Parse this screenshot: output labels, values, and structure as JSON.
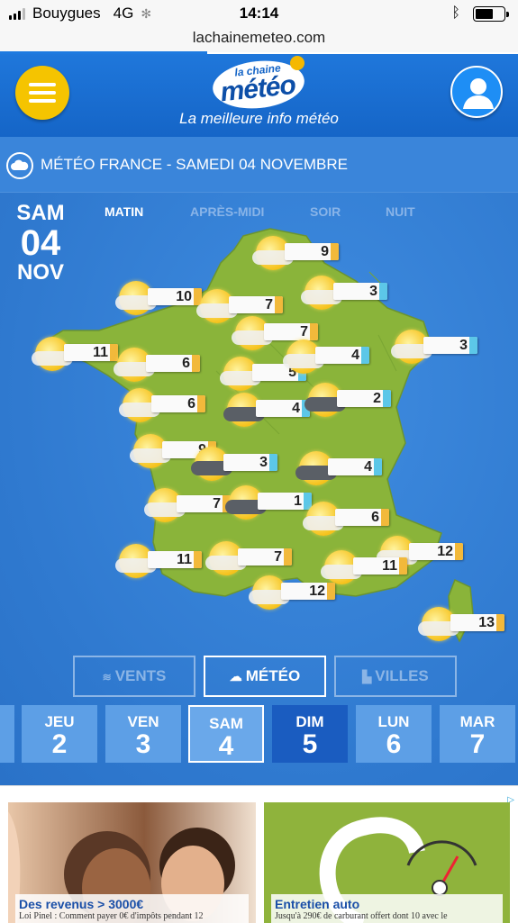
{
  "status": {
    "carrier": "Bouygues",
    "network": "4G",
    "time": "14:14"
  },
  "browser": {
    "url": "lachainemeteo.com"
  },
  "header": {
    "logo_small": "la chaine",
    "logo_big": "météo",
    "tagline": "La meilleure info météo"
  },
  "title_bar": {
    "text": "MÉTÉO FRANCE - SAMEDI 04 NOVEMBRE"
  },
  "date": {
    "day": "SAM",
    "num": "04",
    "month": "NOV"
  },
  "periods": [
    "MATIN",
    "APRÈS-MIDI",
    "SOIR",
    "NUIT"
  ],
  "active_period": "MATIN",
  "cities": [
    {
      "temp": "9",
      "icon": "sun-cloud",
      "bar": "#f2b93b"
    },
    {
      "temp": "10",
      "icon": "sun-cloud",
      "bar": "#f2b93b"
    },
    {
      "temp": "7",
      "icon": "sun-cloud",
      "bar": "#f2b93b"
    },
    {
      "temp": "3",
      "icon": "sun-cloud",
      "bar": "#5cc7e8"
    },
    {
      "temp": "7",
      "icon": "sun-cloud",
      "bar": "#f2b93b"
    },
    {
      "temp": "11",
      "icon": "sun-cloud",
      "bar": "#f2b93b"
    },
    {
      "temp": "6",
      "icon": "sun-cloud",
      "bar": "#f2b93b"
    },
    {
      "temp": "5",
      "icon": "sun-cloud",
      "bar": "#5cc7e8"
    },
    {
      "temp": "4",
      "icon": "sun-cloud",
      "bar": "#5cc7e8"
    },
    {
      "temp": "3",
      "icon": "sun-cloud",
      "bar": "#5cc7e8"
    },
    {
      "temp": "6",
      "icon": "sun-cloud",
      "bar": "#f2b93b"
    },
    {
      "temp": "4",
      "icon": "sun-dark-cloud",
      "bar": "#5cc7e8"
    },
    {
      "temp": "2",
      "icon": "sun-storm",
      "bar": "#5cc7e8"
    },
    {
      "temp": "9",
      "icon": "sun-cloud",
      "bar": "#f2b93b"
    },
    {
      "temp": "3",
      "icon": "sun-dark-cloud",
      "bar": "#5cc7e8"
    },
    {
      "temp": "4",
      "icon": "sun-dark-cloud",
      "bar": "#5cc7e8"
    },
    {
      "temp": "7",
      "icon": "sun-cloud",
      "bar": "#f2b93b"
    },
    {
      "temp": "1",
      "icon": "sun-dark-cloud",
      "bar": "#5cc7e8"
    },
    {
      "temp": "6",
      "icon": "sun-cloud",
      "bar": "#f2b93b"
    },
    {
      "temp": "11",
      "icon": "sun-cloud",
      "bar": "#f2b93b"
    },
    {
      "temp": "7",
      "icon": "sun-cloud",
      "bar": "#f2b93b"
    },
    {
      "temp": "12",
      "icon": "sun-cloud",
      "bar": "#f2b93b"
    },
    {
      "temp": "11",
      "icon": "sun-cloud",
      "bar": "#f2b93b"
    },
    {
      "temp": "12",
      "icon": "sun-cloud",
      "bar": "#f2b93b"
    },
    {
      "temp": "13",
      "icon": "sun-cloud",
      "bar": "#f2b93b"
    }
  ],
  "tabs": {
    "vents": "VENTS",
    "meteo": "MÉTÉO",
    "villes": "VILLES"
  },
  "days": [
    {
      "name": "JEU",
      "num": "2"
    },
    {
      "name": "VEN",
      "num": "3"
    },
    {
      "name": "SAM",
      "num": "4"
    },
    {
      "name": "DIM",
      "num": "5"
    },
    {
      "name": "LUN",
      "num": "6"
    },
    {
      "name": "MAR",
      "num": "7"
    }
  ],
  "ads": [
    {
      "title": "Des revenus > 3000€",
      "text": "Loi Pinel : Comment payer 0€ d'impôts pendant 12"
    },
    {
      "title": "Entretien auto",
      "text": "Jusqu'à 290€ de carburant offert dont 10 avec le"
    }
  ],
  "colors": {
    "header": "#1f77db",
    "accent": "#f5c400",
    "map_land": "#8ab43a",
    "sea": "#3a85da"
  }
}
